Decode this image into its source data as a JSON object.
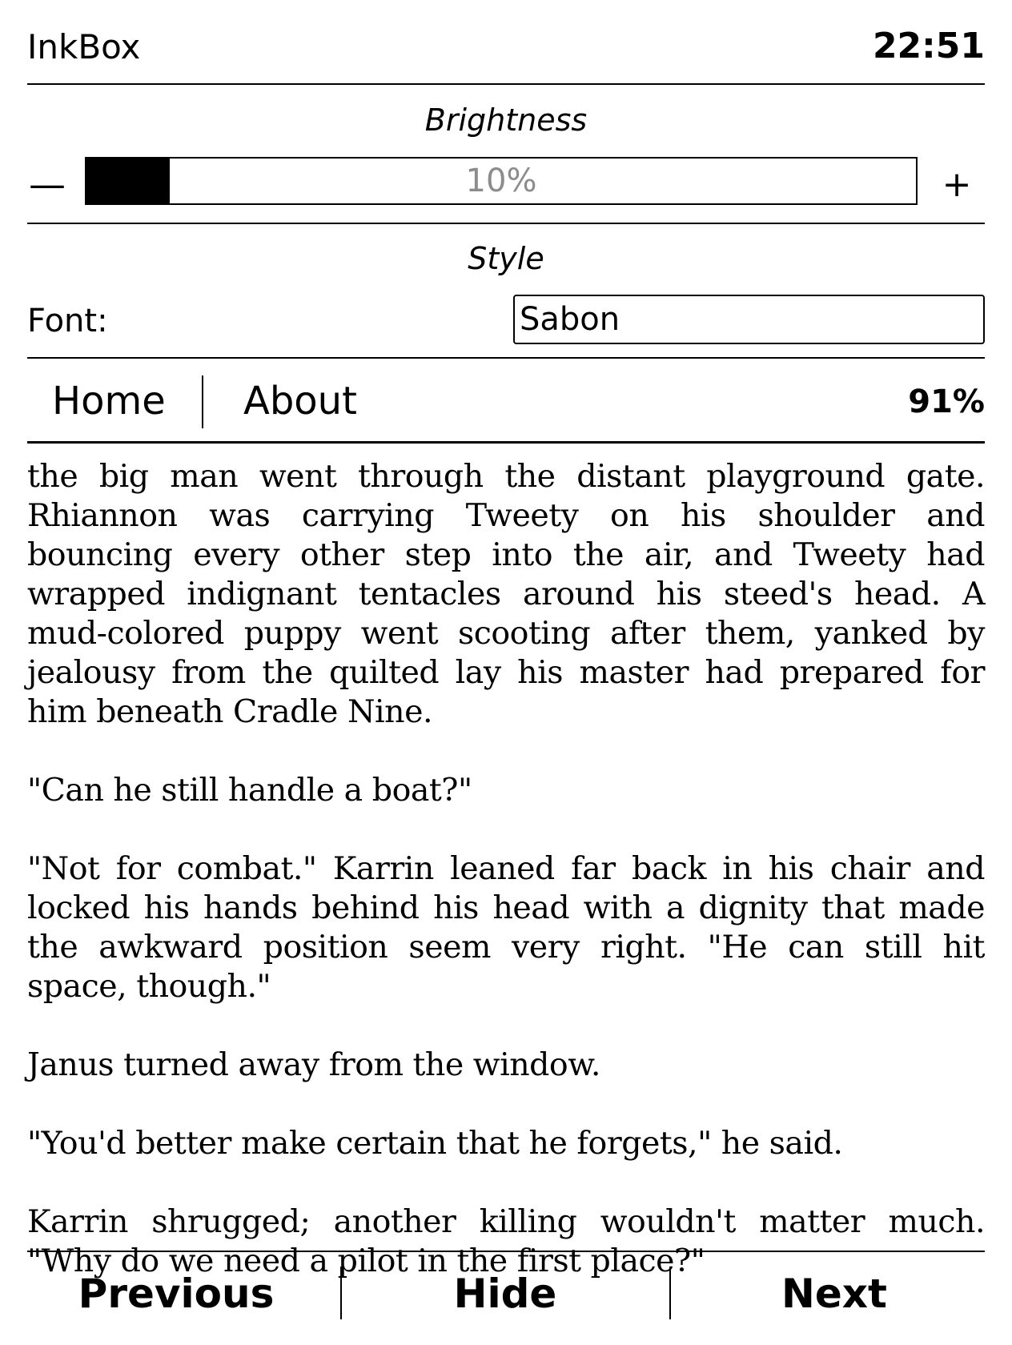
{
  "status_bar": {
    "app_name": "InkBox",
    "time": "22:51"
  },
  "brightness": {
    "title": "Brightness",
    "decrease_label": "—",
    "increase_label": "+",
    "value_label": "10%",
    "value": 0.1
  },
  "style": {
    "title": "Style",
    "font_label": "Font:",
    "font_value": "Sabon"
  },
  "nav": {
    "home_label": "Home",
    "about_label": "About",
    "progress": "91%"
  },
  "reading": {
    "paragraphs": [
      "the big man went through the distant playground gate. Rhiannon was carrying Tweety on his shoulder and bouncing every other step into the air, and Tweety had wrapped indignant tentacles around his steed's head. A mud-colored puppy went scooting after them, yanked by jealousy from the quilted lay his master had prepared for him beneath Cradle Nine.",
      "\"Can he still handle a boat?\"",
      "\"Not for combat.\" Karrin leaned far back in his chair and locked his hands behind his head with a dignity that made the awkward position seem very right. \"He can still hit space, though.\"",
      "Janus turned away from the window.",
      "\"You'd better make certain that he forgets,\" he said.",
      "Karrin shrugged; another killing wouldn't matter much. \"Why do we need a pilot in the first place?\""
    ]
  },
  "bottom_bar": {
    "previous_label": "Previous",
    "hide_label": "Hide",
    "next_label": "Next"
  }
}
